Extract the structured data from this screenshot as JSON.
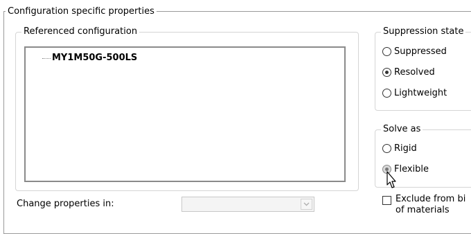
{
  "outer_group": {
    "title": "Configuration specific properties"
  },
  "referenced_config": {
    "title": "Referenced configuration",
    "items": [
      "MY1M50G-500LS"
    ]
  },
  "suppression": {
    "title": "Suppression state",
    "options": [
      "Suppressed",
      "Resolved",
      "Lightweight"
    ],
    "selected": "Resolved"
  },
  "solve_as": {
    "title": "Solve as",
    "options": [
      "Rigid",
      "Flexible"
    ],
    "selected": "Flexible"
  },
  "change_properties": {
    "label": "Change properties in:",
    "value": ""
  },
  "exclude_bom": {
    "label_line1": "Exclude from bi",
    "label_line2": "of materials",
    "checked": false
  },
  "icons": [
    "radio-button",
    "chevron-down-icon",
    "mouse-cursor-icon"
  ]
}
